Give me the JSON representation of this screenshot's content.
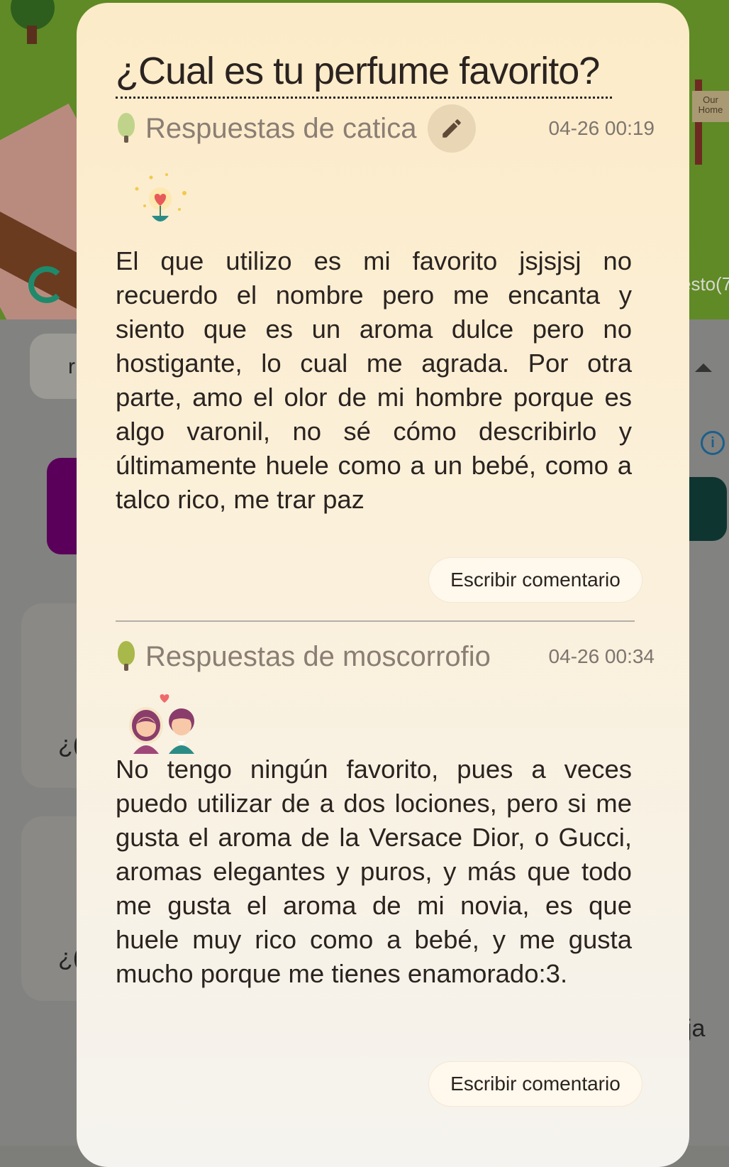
{
  "background": {
    "sign_text": "Our Home",
    "right_partial_text": "esto(7",
    "left_partial_1": "r",
    "left_partial_2": "¿(",
    "left_partial_3": "¿(",
    "right_partial_2": "ja"
  },
  "modal": {
    "title": "¿Cual es tu perfume favorito?",
    "answers": [
      {
        "author": "Respuestas de catica",
        "date": "04-26 00:19",
        "text": "El que utilizo es mi favorito jsjsjsj no recuerdo el nombre pero me encanta y siento que es un aroma dulce pero no hostigante, lo cual me agrada. Por otra parte, amo el olor de mi hombre porque es algo varonil, no sé cómo describirlo y últimamente huele como a un bebé, como a talco rico, me trar paz",
        "comment_label": "Escribir comentario",
        "avatar_icon": "sprout-question-icon",
        "sticker_icon": "heart-flower-sparkle-icon"
      },
      {
        "author": "Respuestas de moscorrofio",
        "date": "04-26 00:34",
        "text": "No tengo ningún favorito, pues a veces puedo utilizar de a dos lociones, pero si me gusta el aroma de la Versace Dior, o Gucci, aromas elegantes y puros, y más que todo me gusta el aroma de mi novia, es que huele muy rico como a bebé, y me gusta mucho porque me tienes enamorado:3.",
        "comment_label": "Escribir comentario",
        "avatar_icon": "sprout-face-icon",
        "sticker_icon": "couple-heart-icon"
      }
    ],
    "edit_icon": "pencil-icon"
  },
  "colors": {
    "modal_top": "#fcebc8",
    "modal_bottom": "#f5f3ef",
    "author_gray": "#8a7e74",
    "edit_bg": "#e8d6b5"
  }
}
